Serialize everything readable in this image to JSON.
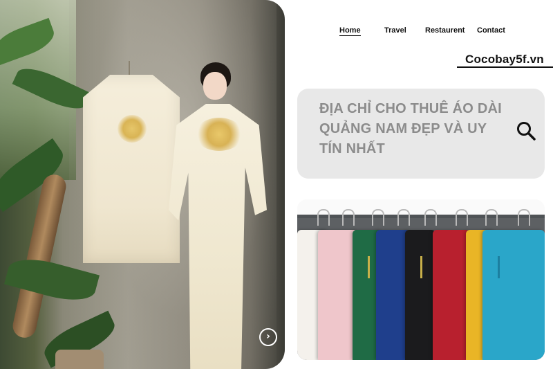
{
  "nav": {
    "items": [
      {
        "label": "Home",
        "active": true
      },
      {
        "label": "Travel",
        "active": false
      },
      {
        "label": "Restaurent",
        "active": false
      },
      {
        "label": "Contact",
        "active": false
      }
    ]
  },
  "brand": {
    "name": "Cocobay5f.vn"
  },
  "search": {
    "title": "ĐỊA CHỈ CHO THUÊ ÁO DÀI QUẢNG NAM ĐẸP VÀ UY TÍN NHẤT",
    "icon": "search-icon"
  },
  "hero": {
    "image": "woman-in-cream-ao-dai-beside-hanging-mens-ao-dai",
    "next_icon": "chevron-right-icon"
  },
  "products": {
    "image": "row-of-colored-ao-dai-on-hangers",
    "colors": [
      "#f4f1ec",
      "#efc6cb",
      "#1f6b45",
      "#1f3f8c",
      "#1b1b1d",
      "#b8202e",
      "#e9b526",
      "#2aa6c9"
    ]
  }
}
